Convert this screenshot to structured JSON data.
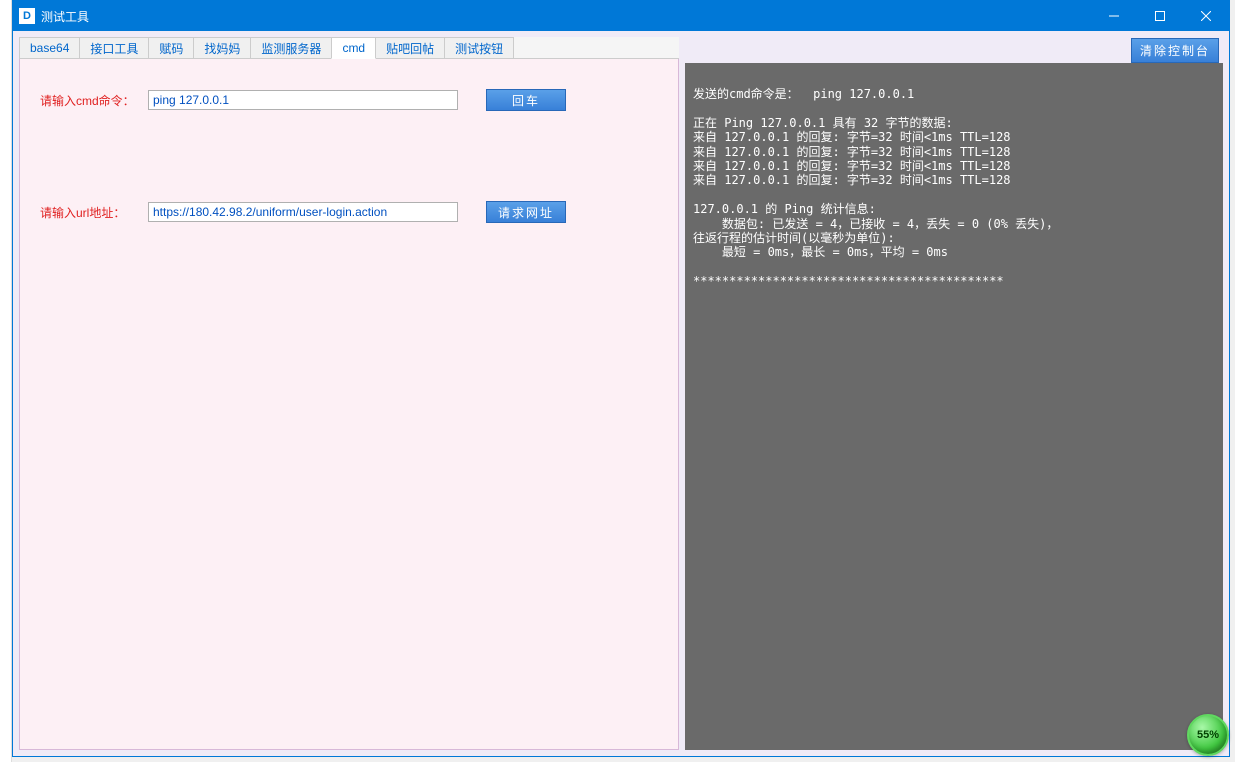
{
  "window": {
    "title": "测试工具",
    "icon_letter": "D"
  },
  "tabs": [
    {
      "label": "base64",
      "active": false
    },
    {
      "label": "接口工具",
      "active": false
    },
    {
      "label": "赋码",
      "active": false
    },
    {
      "label": "找妈妈",
      "active": false
    },
    {
      "label": "监测服务器",
      "active": false
    },
    {
      "label": "cmd",
      "active": true
    },
    {
      "label": "贴吧回帖",
      "active": false
    },
    {
      "label": "测试按钮",
      "active": false
    }
  ],
  "form": {
    "cmd_label": "请输入cmd命令：",
    "cmd_value": "ping 127.0.0.1",
    "cmd_button": "回车",
    "url_label": "请输入url地址：",
    "url_value": "https://180.42.98.2/uniform/user-login.action",
    "url_button": "请求网址"
  },
  "toolbar": {
    "clear_label": "清除控制台"
  },
  "console_output": "发送的cmd命令是：  ping 127.0.0.1\n\n正在 Ping 127.0.0.1 具有 32 字节的数据:\n来自 127.0.0.1 的回复: 字节=32 时间<1ms TTL=128\n来自 127.0.0.1 的回复: 字节=32 时间<1ms TTL=128\n来自 127.0.0.1 的回复: 字节=32 时间<1ms TTL=128\n来自 127.0.0.1 的回复: 字节=32 时间<1ms TTL=128\n\n127.0.0.1 的 Ping 统计信息:\n    数据包: 已发送 = 4，已接收 = 4，丢失 = 0 (0% 丢失)，\n往返行程的估计时间(以毫秒为单位):\n    最短 = 0ms，最长 = 0ms，平均 = 0ms\n\n*******************************************",
  "progress": {
    "label": "55%"
  }
}
